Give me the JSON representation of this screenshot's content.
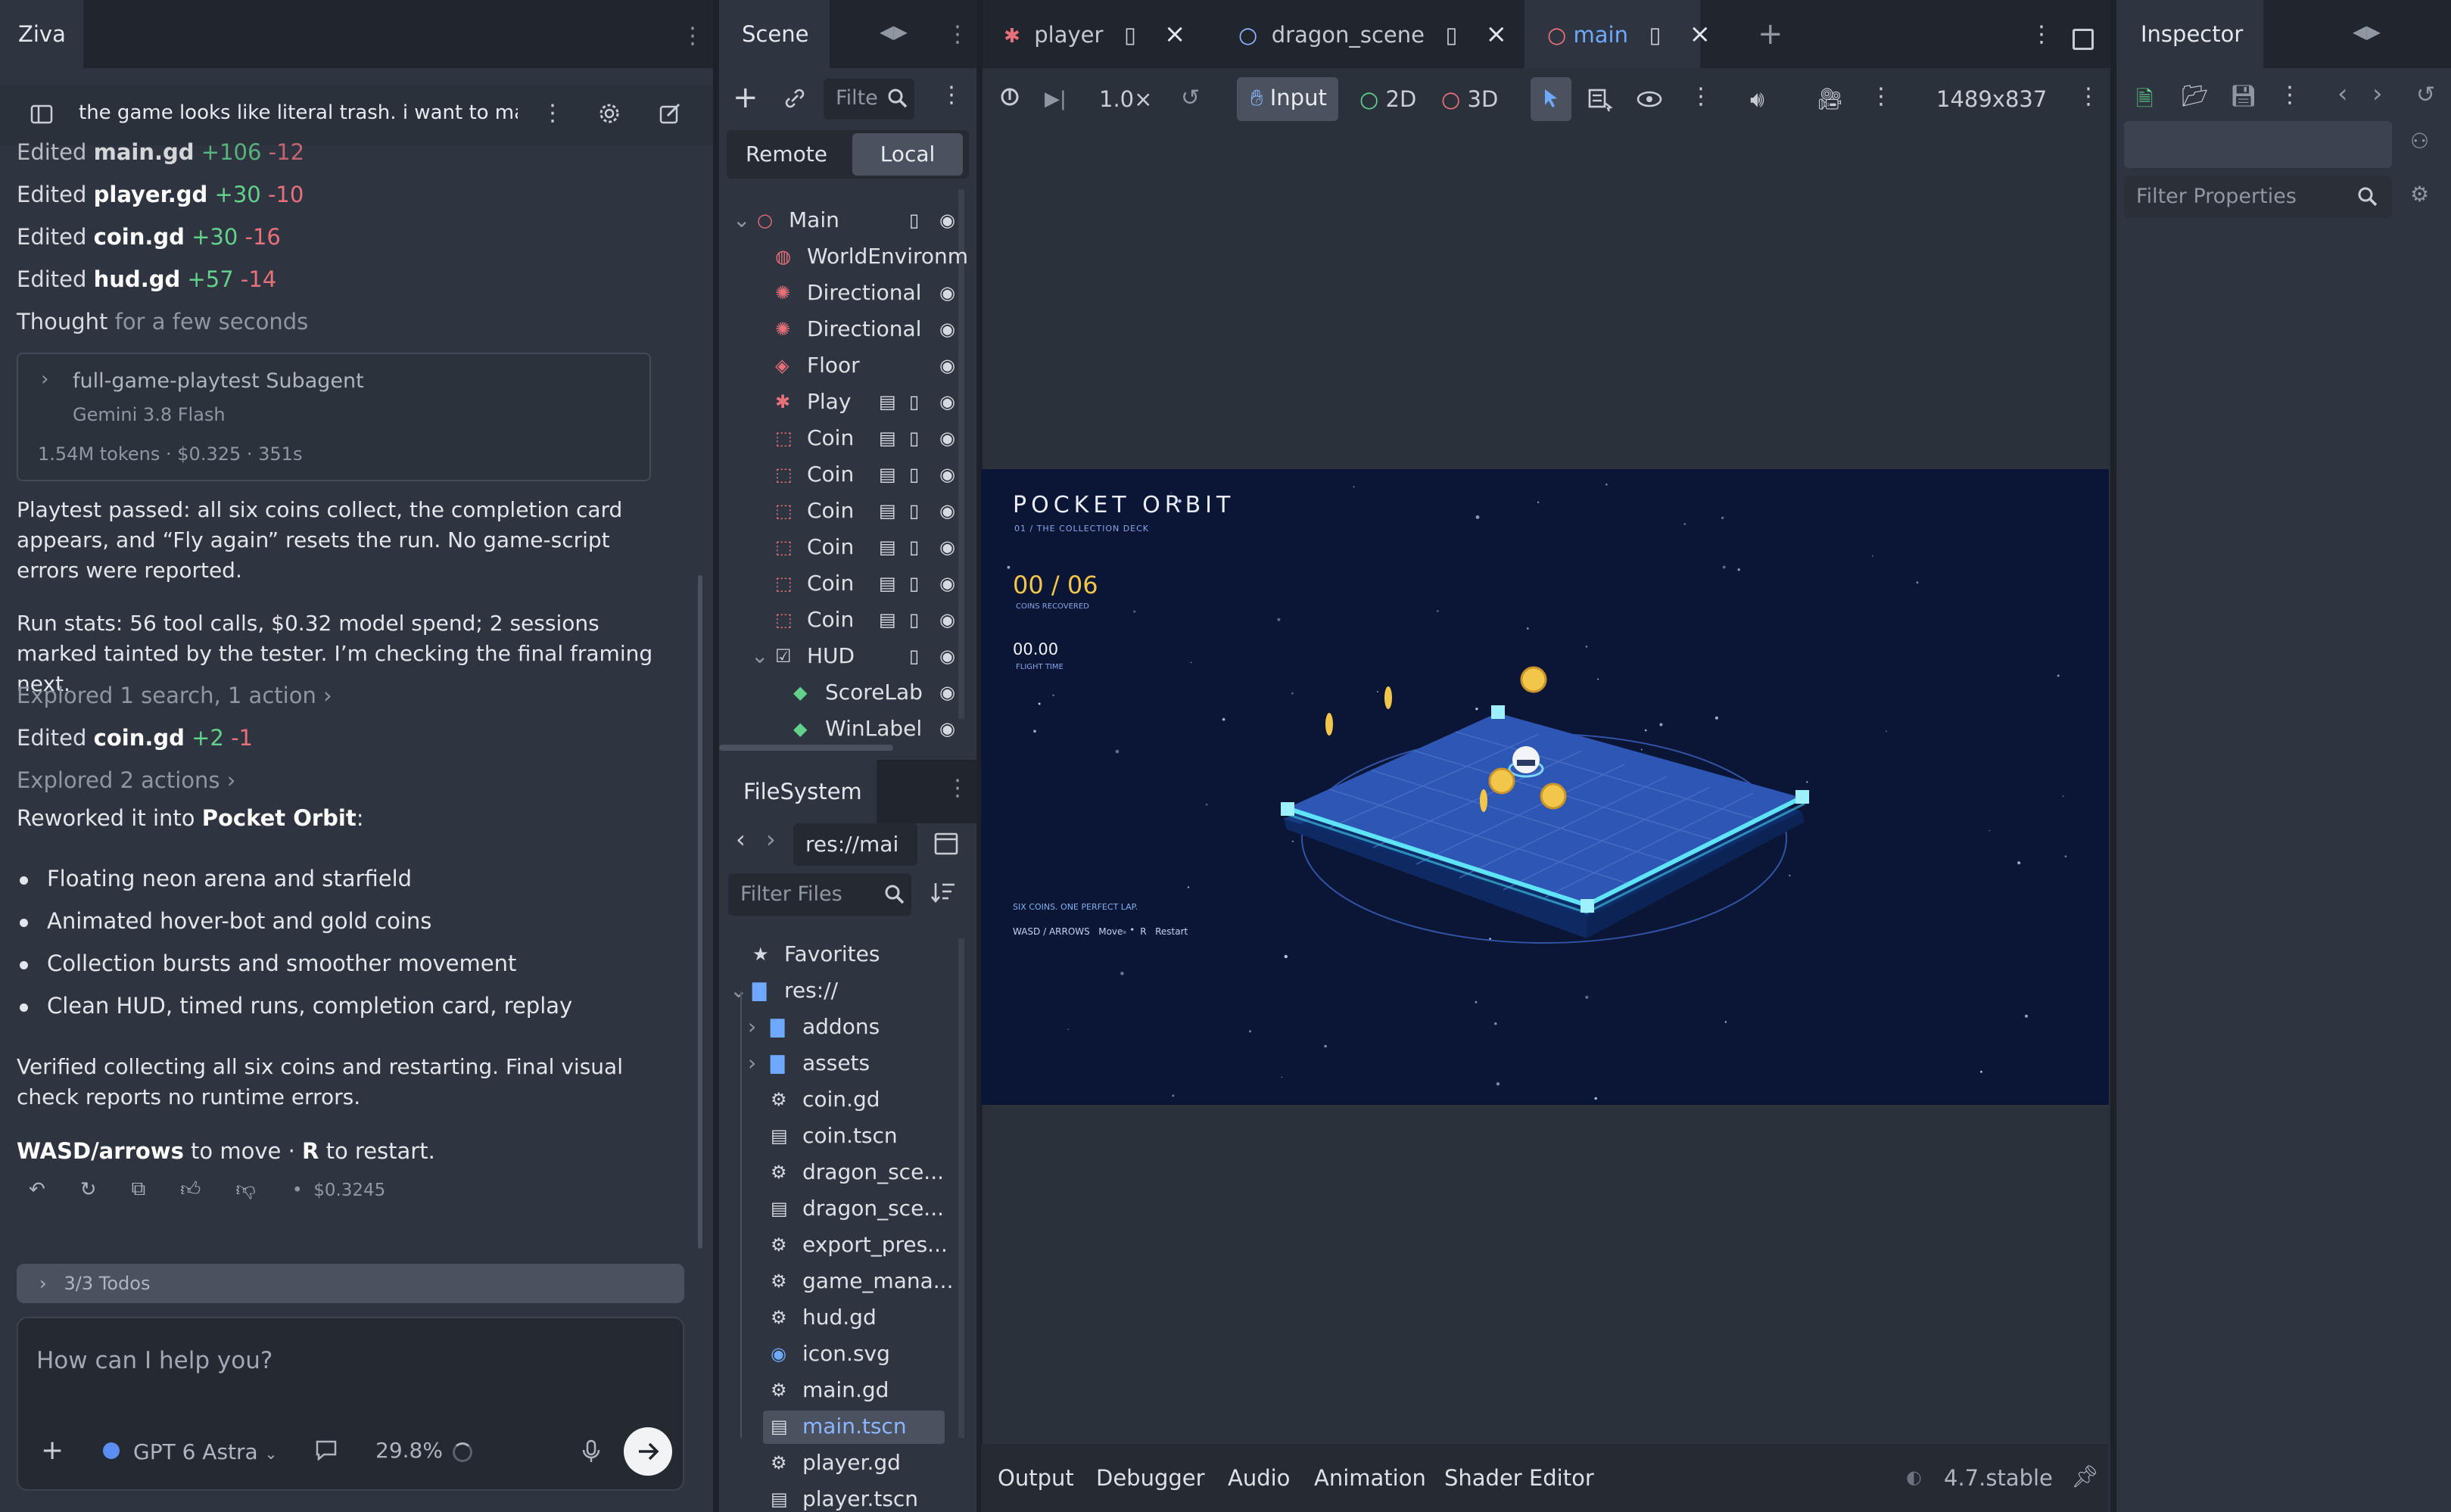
{
  "ziva": {
    "tab_title": "Ziva",
    "chat_title": "the game looks like literal trash. i want to make t...",
    "edits": [
      {
        "label": "Edited",
        "file": "main.gd",
        "add": "+106",
        "del": "-12"
      },
      {
        "label": "Edited",
        "file": "player.gd",
        "add": "+30",
        "del": "-10"
      },
      {
        "label": "Edited",
        "file": "coin.gd",
        "add": "+30",
        "del": "-16"
      },
      {
        "label": "Edited",
        "file": "hud.gd",
        "add": "+57",
        "del": "-14"
      }
    ],
    "thought_label": "Thought",
    "thought_time": "for a few seconds",
    "subagent": {
      "name": "full-game-playtest Subagent",
      "model": "Gemini 3.8 Flash",
      "stats": "1.54M tokens · $0.325 · 351s"
    },
    "para1": "Playtest passed: all six coins collect, the completion card appears, and “Fly again” resets the run. No game-script errors were reported.",
    "para2": "Run stats: 56 tool calls, $0.32 model spend; 2 sessions marked tainted by the tester. I’m checking the final framing next.",
    "explored1": "Explored 1 search, 1 action",
    "edit_coin": {
      "label": "Edited",
      "file": "coin.gd",
      "add": "+2",
      "del": "-1"
    },
    "explored2": "Explored 2 actions",
    "reworked_prefix": "Reworked it into ",
    "reworked_name": "Pocket Orbit",
    "reworked_suffix": ":",
    "bullets": [
      "Floating neon arena and starfield",
      "Animated hover-bot and gold coins",
      "Collection bursts and smoother movement",
      "Clean HUD, timed runs, completion card, replay"
    ],
    "verified": "Verified collecting all six coins and restarting. Final visual check reports no runtime errors.",
    "controls_keys1": "WASD/arrows",
    "controls_mid": " to move · ",
    "controls_keys2": "R",
    "controls_end": " to restart.",
    "cost": "$0.3245",
    "todos": "3/3 Todos",
    "input_placeholder": "How can I help you?",
    "model": "GPT 6 Astra",
    "context_pct": "29.8%"
  },
  "scene": {
    "tab": "Scene",
    "filter_placeholder": "Filte",
    "remote": "Remote",
    "local": "Local",
    "nodes": [
      "Main",
      "WorldEnvironmer",
      "Directional",
      "Directional",
      "Floor",
      "Play",
      "Coin",
      "Coin",
      "Coin",
      "Coin",
      "Coin",
      "Coin",
      "HUD",
      "ScoreLab",
      "WinLabel"
    ]
  },
  "filesystem": {
    "tab": "FileSystem",
    "path": "res://mai",
    "filter_placeholder": "Filter Files",
    "items": [
      "Favorites",
      "res://",
      "addons",
      "assets",
      "coin.gd",
      "coin.tscn",
      "dragon_sce...",
      "dragon_sce...",
      "export_pres...",
      "game_mana...",
      "hud.gd",
      "icon.svg",
      "main.gd",
      "main.tscn",
      "player.gd",
      "player.tscn"
    ]
  },
  "editor": {
    "tabs": [
      "player",
      "dragon_scene",
      "main"
    ],
    "zoom": "1.0×",
    "input": "Input",
    "mode2d": "2D",
    "mode3d": "3D",
    "resolution": "1489x837",
    "bottom_tabs": [
      "Output",
      "Debugger",
      "Audio",
      "Animation",
      "Shader Editor"
    ],
    "version": "4.7.stable"
  },
  "game": {
    "title": "POCKET ORBIT",
    "subtitle": "01  /  THE COLLECTION DECK",
    "counter": "00 / 06",
    "counter_label": "COINS RECOVERED",
    "time": "00.00",
    "time_label": "FLIGHT TIME",
    "tagline": "SIX COINS. ONE PERFECT LAP.",
    "hint_keys": "WASD / ARROWS",
    "hint_move": "Move",
    "hint_r": "R",
    "hint_restart": "Restart"
  },
  "inspector": {
    "tab": "Inspector",
    "filter_placeholder": "Filter Properties"
  },
  "colors": {
    "accent": "#6ea8ff",
    "add": "#62d18b",
    "del": "#e8707a",
    "coin": "#f2c64a",
    "neon": "#4fd8f0"
  }
}
